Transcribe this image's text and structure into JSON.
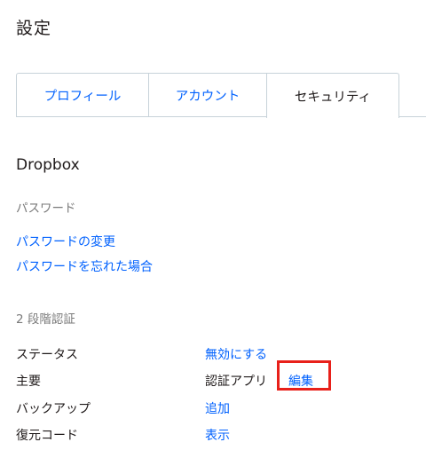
{
  "page": {
    "title": "設定"
  },
  "tabs": [
    {
      "label": "プロフィール"
    },
    {
      "label": "アカウント"
    },
    {
      "label": "セキュリティ"
    }
  ],
  "section": {
    "heading": "Dropbox",
    "password_label": "パスワード",
    "change_password": "パスワードの変更",
    "forgot_password": "パスワードを忘れた場合",
    "two_step_label": "2 段階認証"
  },
  "rows": [
    {
      "label": "ステータス",
      "value": "無効にする"
    },
    {
      "label": "主要",
      "value": "認証アプリ",
      "action": "編集"
    },
    {
      "label": "バックアップ",
      "value": "追加"
    },
    {
      "label": "復元コード",
      "value": "表示"
    }
  ],
  "colors": {
    "link": "#0061fe",
    "highlight": "#e8201a"
  }
}
